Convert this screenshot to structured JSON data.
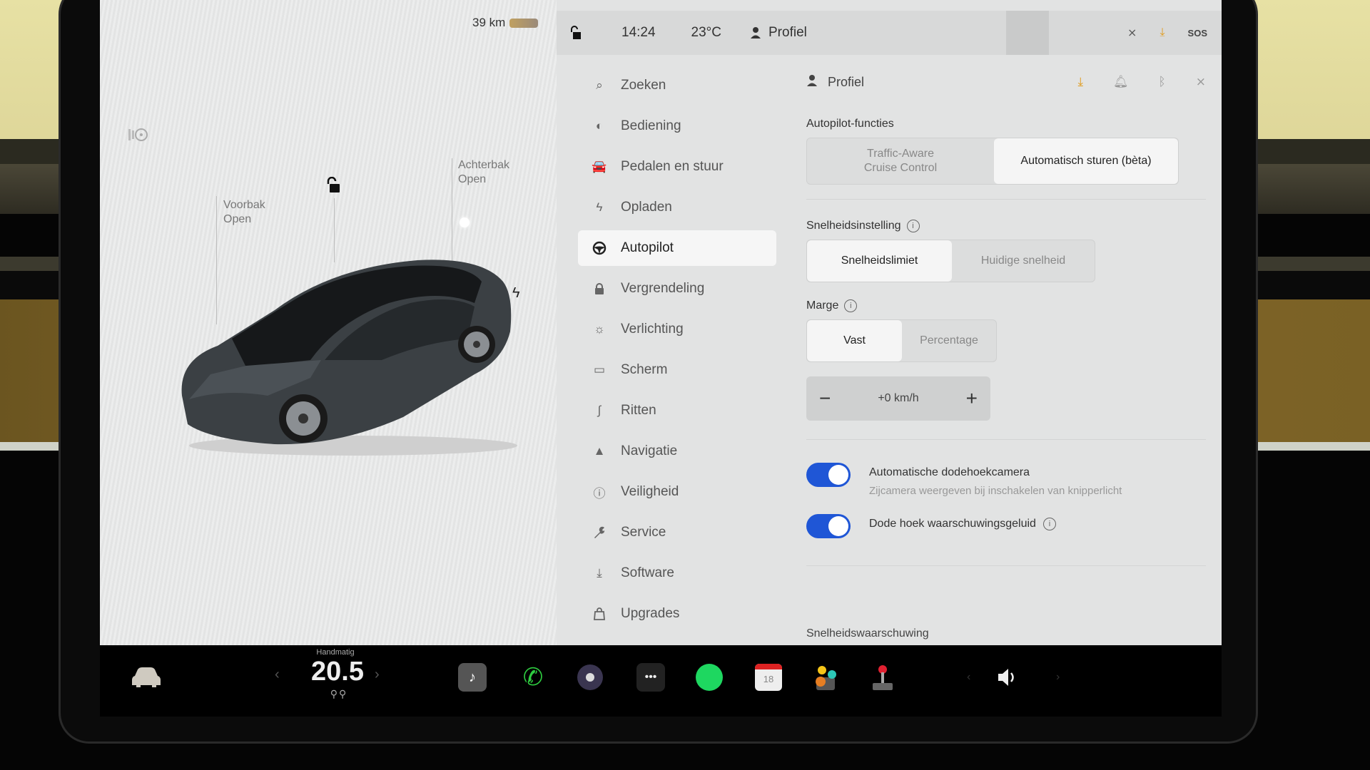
{
  "status_bar": {
    "range": "39 km",
    "time": "14:24",
    "temperature": "23°C",
    "profile_label": "Profiel",
    "icons": [
      "lock-open-icon",
      "person-icon",
      "no-signal-icon",
      "download-icon",
      "sos-icon"
    ]
  },
  "car_panel": {
    "frunk_label": "Voorbak",
    "frunk_status": "Open",
    "trunk_label": "Achterbak",
    "trunk_status": "Open",
    "icons": [
      "headlight-icon",
      "unlock-icon",
      "charge-port-icon"
    ]
  },
  "menu": {
    "items": [
      {
        "label": "Zoeken",
        "icon": "search-icon",
        "glyph": "⌕"
      },
      {
        "label": "Bediening",
        "icon": "toggle-icon",
        "glyph": "◐"
      },
      {
        "label": "Pedalen en stuur",
        "icon": "car-icon",
        "glyph": "🚘"
      },
      {
        "label": "Opladen",
        "icon": "bolt-icon",
        "glyph": "ϟ"
      },
      {
        "label": "Autopilot",
        "icon": "steering-wheel-icon",
        "glyph": "⊛",
        "active": true
      },
      {
        "label": "Vergrendeling",
        "icon": "lock-icon",
        "glyph": "🔒"
      },
      {
        "label": "Verlichting",
        "icon": "sun-icon",
        "glyph": "☼"
      },
      {
        "label": "Scherm",
        "icon": "display-icon",
        "glyph": "▭"
      },
      {
        "label": "Ritten",
        "icon": "trips-icon",
        "glyph": "∫"
      },
      {
        "label": "Navigatie",
        "icon": "navigation-icon",
        "glyph": "▲"
      },
      {
        "label": "Veiligheid",
        "icon": "safety-icon",
        "glyph": "ⓘ"
      },
      {
        "label": "Service",
        "icon": "wrench-icon",
        "glyph": "🔧"
      },
      {
        "label": "Software",
        "icon": "download-icon",
        "glyph": "⤓"
      },
      {
        "label": "Upgrades",
        "icon": "bag-icon",
        "glyph": "⌂"
      }
    ]
  },
  "content": {
    "profile_label": "Profiel",
    "header_icons": [
      "download-icon",
      "bell-icon",
      "bluetooth-icon",
      "no-signal-icon"
    ],
    "autopilot_features": {
      "label": "Autopilot-functies",
      "options": [
        "Traffic-Aware\nCruise Control",
        "Automatisch sturen (bèta)"
      ],
      "selected": 1
    },
    "speed_setting": {
      "label": "Snelheidsinstelling",
      "options": [
        "Snelheidslimiet",
        "Huidige snelheid"
      ],
      "selected": 0
    },
    "margin": {
      "label": "Marge",
      "options": [
        "Vast",
        "Percentage"
      ],
      "selected": 0,
      "value": "+0 km/h",
      "minus": "−",
      "plus": "+"
    },
    "toggles": [
      {
        "label": "Automatische dodehoekcamera",
        "sub": "Zijcamera weergeven bij inschakelen van knipperlicht",
        "on": true
      },
      {
        "label": "Dode hoek waarschuwingsgeluid",
        "on": true,
        "info": true
      }
    ],
    "next_section": "Snelheidswaarschuwing"
  },
  "dock": {
    "climate_mode": "Handmatig",
    "climate_temp": "20.5",
    "calendar_day": "18",
    "apps": [
      "car-icon",
      "music-icon",
      "phone-icon",
      "camera-icon",
      "more-icon",
      "spotify-icon",
      "calendar-icon",
      "toybox-icon",
      "arcade-icon",
      "volume-icon"
    ],
    "accent_colors": {
      "phone": "#2ecc40",
      "spotify": "#1ed760",
      "toggle": "#1f56d6"
    }
  }
}
